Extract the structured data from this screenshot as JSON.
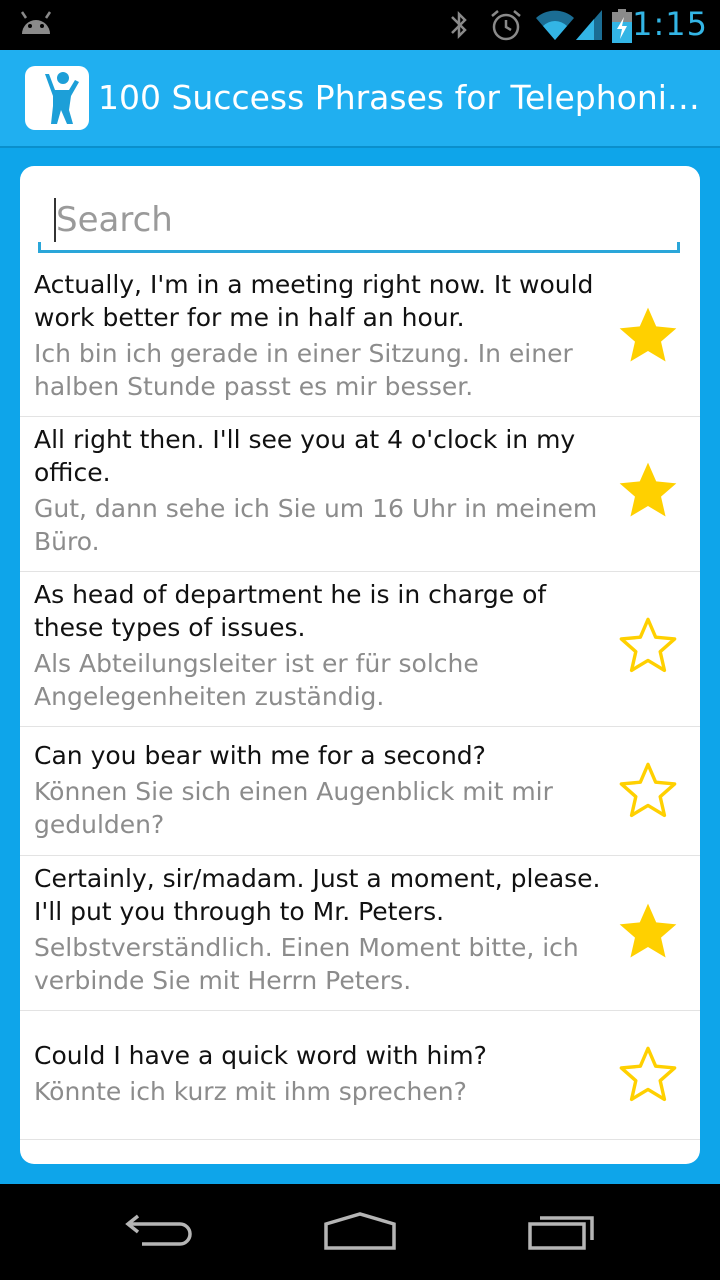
{
  "status_bar": {
    "time": "1:15",
    "icons": [
      "android-icon",
      "bluetooth-icon",
      "alarm-icon",
      "wifi-icon",
      "signal-icon",
      "battery-charging-icon"
    ]
  },
  "action_bar": {
    "app_icon": "person-arms-up-icon",
    "title": "100 Success Phrases for Telephoni…"
  },
  "search": {
    "placeholder": "Search",
    "value": ""
  },
  "phrases": [
    {
      "en": "Actually, I'm in a meeting right now. It would work better for me in half an hour.",
      "de": "Ich bin ich gerade in einer Sitzung. In einer halben Stunde passt es mir besser.",
      "favorite": true
    },
    {
      "en": "All right then. I'll see you at 4 o'clock in my office.",
      "de": "Gut, dann sehe ich Sie um 16 Uhr in meinem Büro.",
      "favorite": true
    },
    {
      "en": "As head of department he is in charge of these types of issues.",
      "de": "Als Abteilungsleiter ist er für solche Angelegenheiten zuständig.",
      "favorite": false
    },
    {
      "en": "Can you bear with me for a second?",
      "de": "Können Sie sich einen Augenblick mit mir gedulden?",
      "favorite": false
    },
    {
      "en": "Certainly, sir/madam. Just a moment, please. I'll put you through to Mr. Peters.",
      "de": "Selbstverständlich. Einen Moment bitte, ich verbinde Sie mit Herrn Peters.",
      "favorite": true
    },
    {
      "en": "Could I have a quick word with him?",
      "de": "Könnte ich kurz mit ihm sprechen?",
      "favorite": false
    }
  ],
  "colors": {
    "accent": "#20aff0",
    "star": "#ffd000"
  },
  "nav_bar": {
    "icons": [
      "back-icon",
      "home-icon",
      "recent-apps-icon"
    ]
  }
}
